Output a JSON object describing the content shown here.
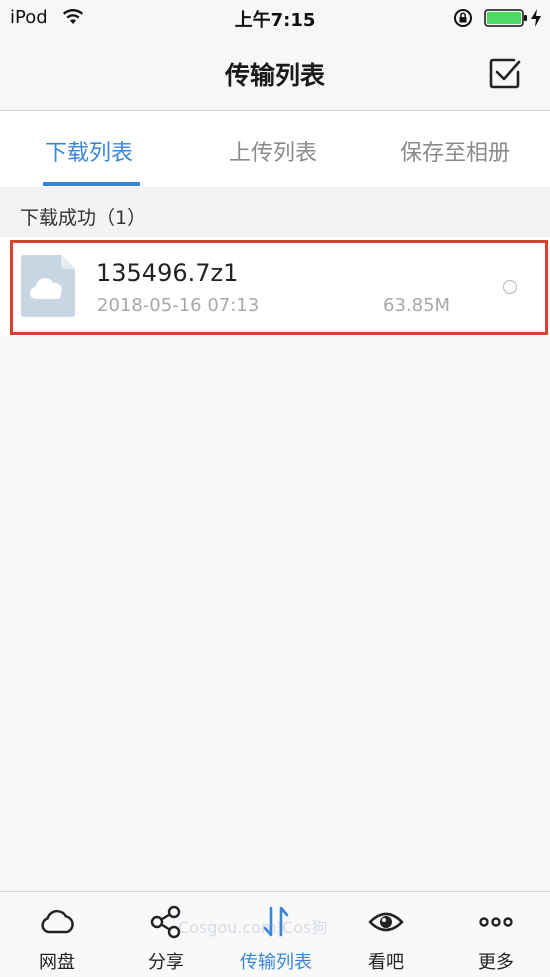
{
  "status_bar": {
    "carrier": "iPod",
    "time": "上午7:15"
  },
  "nav": {
    "title": "传输列表"
  },
  "tabs": [
    {
      "label": "下载列表",
      "active": true
    },
    {
      "label": "上传列表",
      "active": false
    },
    {
      "label": "保存至相册",
      "active": false
    }
  ],
  "section": {
    "label": "下载成功（1）"
  },
  "files": [
    {
      "name": "135496.7z1",
      "date": "2018-05-16 07:13",
      "size": "63.85M"
    }
  ],
  "tab_bar": [
    {
      "label": "网盘",
      "icon": "cloud-icon"
    },
    {
      "label": "分享",
      "icon": "share-icon"
    },
    {
      "label": "传输列表",
      "icon": "transfer-icon",
      "active": true
    },
    {
      "label": "看吧",
      "icon": "eye-icon"
    },
    {
      "label": "更多",
      "icon": "more-icon"
    }
  ],
  "watermark": "Cosgou.com|Cos狗",
  "colors": {
    "accent": "#3a86d6",
    "highlight": "#d9402d"
  }
}
